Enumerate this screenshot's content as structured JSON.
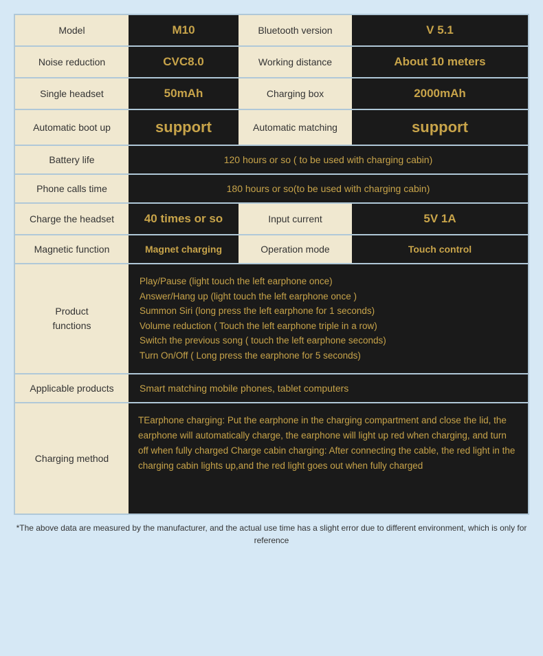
{
  "table": {
    "rows": [
      {
        "id": "model-bluetooth",
        "cells": [
          {
            "type": "label",
            "text": "Model"
          },
          {
            "type": "value",
            "text": "M10"
          },
          {
            "type": "label",
            "text": "Bluetooth version"
          },
          {
            "type": "value",
            "text": "V 5.1"
          }
        ]
      },
      {
        "id": "noise-working",
        "cells": [
          {
            "type": "label",
            "text": "Noise reduction"
          },
          {
            "type": "value",
            "text": "CVC8.0"
          },
          {
            "type": "label",
            "text": "Working distance"
          },
          {
            "type": "value",
            "text": "About 10 meters"
          }
        ]
      },
      {
        "id": "single-charging",
        "cells": [
          {
            "type": "label",
            "text": "Single headset"
          },
          {
            "type": "value",
            "text": "50mAh"
          },
          {
            "type": "label",
            "text": "Charging box"
          },
          {
            "type": "value",
            "text": "2000mAh"
          }
        ]
      },
      {
        "id": "boot-matching",
        "cells": [
          {
            "type": "label",
            "text": "Automatic boot up"
          },
          {
            "type": "value-large",
            "text": "support"
          },
          {
            "type": "label",
            "text": "Automatic matching"
          },
          {
            "type": "value-large",
            "text": "support"
          }
        ]
      },
      {
        "id": "battery-life",
        "cells": [
          {
            "type": "label",
            "text": "Battery life"
          },
          {
            "type": "full",
            "text": "120 hours or so ( to be used with charging cabin)"
          }
        ]
      },
      {
        "id": "phone-calls",
        "cells": [
          {
            "type": "label",
            "text": "Phone calls time"
          },
          {
            "type": "full",
            "text": "180 hours or so(to be used with charging cabin)"
          }
        ]
      },
      {
        "id": "charge-input",
        "cells": [
          {
            "type": "label",
            "text": "Charge the headset"
          },
          {
            "type": "value",
            "text": "40 times or so"
          },
          {
            "type": "label",
            "text": "Input current"
          },
          {
            "type": "value",
            "text": "5V 1A"
          }
        ]
      },
      {
        "id": "magnetic-operation",
        "cells": [
          {
            "type": "label",
            "text": "Magnetic function"
          },
          {
            "type": "value",
            "text": "Magnet charging"
          },
          {
            "type": "label",
            "text": "Operation mode"
          },
          {
            "type": "value",
            "text": "Touch control"
          }
        ]
      },
      {
        "id": "product-functions",
        "label": "Product\nfunctions",
        "lines": [
          "Play/Pause (light touch the left earphone once)",
          "Answer/Hang up (light touch the left earphone once )",
          "Summon Siri (long press the left earphone for 1 seconds)",
          "Volume reduction ( Touch the left earphone triple in a row)",
          "Switch the previous song ( touch the left earphone seconds)",
          "Turn On/Off ( Long press the earphone for 5 seconds)"
        ]
      },
      {
        "id": "applicable-products",
        "label": "Applicable products",
        "text": "Smart matching mobile phones, tablet computers"
      },
      {
        "id": "charging-method",
        "label": "Charging method",
        "lines": [
          "TEarphone charging:  Put the earphone in the charging",
          "compartment and close the lid, the earphone will",
          "automatically charge, the earphone will light up",
          "red when charging, and turn off when fully charged",
          "Charge cabin charging: After connecting the cable,",
          "the red light in the charging cabin lights up,and the",
          "red light goes out when fully charged"
        ]
      }
    ],
    "footnote": "*The above data are measured by the manufacturer, and the actual use time has a slight error due to different environment, which is only for reference"
  }
}
